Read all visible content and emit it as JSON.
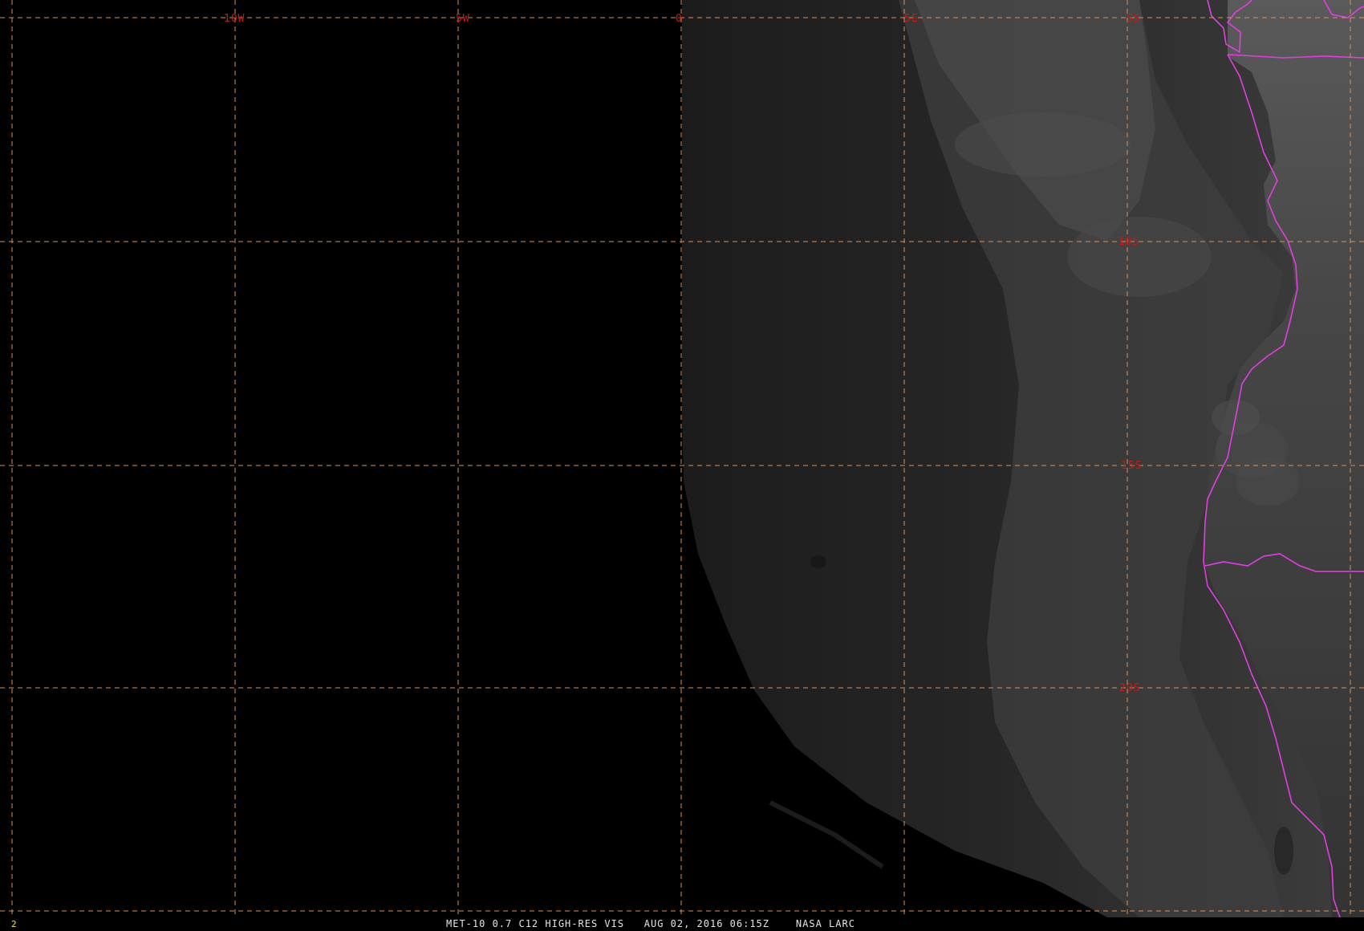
{
  "image": {
    "satellite": "MET-10",
    "channel": "0.7",
    "product": "C12 HIGH-RES VIS",
    "date": "AUG 02, 2016",
    "time": "06:15Z",
    "source": "NASA LARC",
    "frame_number": "2"
  },
  "caption_text": "MET-10 0.7 C12 HIGH-RES VIS   AUG 02, 2016 06:15Z    NASA LARC",
  "grid": {
    "longitude_labels": [
      "10W",
      "5W",
      "0",
      "5E",
      "5S"
    ],
    "latitude_labels": [
      "10S",
      "15S",
      "20S"
    ]
  },
  "colors": {
    "background": "#000000",
    "grid_line": "#d8925c",
    "grid_label": "#cc1a14",
    "political_border": "#e040e0",
    "caption_text": "#e6e6e6",
    "frame_number": "#f0e040"
  }
}
